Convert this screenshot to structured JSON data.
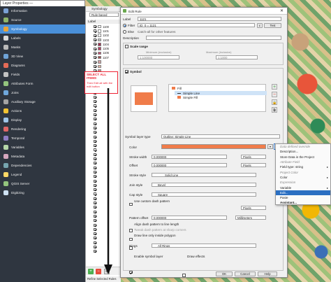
{
  "layer_dialog": {
    "title": "Layer Properties —",
    "sidebar": [
      {
        "label": "Information",
        "color": "#7aa0d4",
        "selected": false
      },
      {
        "label": "Source",
        "color": "#8fb56a",
        "selected": false
      },
      {
        "label": "Symbology",
        "color": "#e8a43a",
        "selected": true
      },
      {
        "label": "Labels",
        "color": "#d9d9d9",
        "selected": false
      },
      {
        "label": "Masks",
        "color": "#b9b9b9",
        "selected": false
      },
      {
        "label": "3D View",
        "color": "#6fa3d6",
        "selected": false
      },
      {
        "label": "Diagrams",
        "color": "#e46b57",
        "selected": false
      },
      {
        "label": "Fields",
        "color": "#c2c2c2",
        "selected": false
      },
      {
        "label": "Attributes Form",
        "color": "#93c47d",
        "selected": false
      },
      {
        "label": "Joins",
        "color": "#6fa8dc",
        "selected": false
      },
      {
        "label": "Auxiliary Storage",
        "color": "#a4a4a4",
        "selected": false
      },
      {
        "label": "Actions",
        "color": "#f1c232",
        "selected": false
      },
      {
        "label": "Display",
        "color": "#9fc5e8",
        "selected": false
      },
      {
        "label": "Rendering",
        "color": "#e06666",
        "selected": false
      },
      {
        "label": "Temporal",
        "color": "#8e7cc3",
        "selected": false
      },
      {
        "label": "Variables",
        "color": "#b6d7a8",
        "selected": false
      },
      {
        "label": "Metadata",
        "color": "#d5a6bd",
        "selected": false
      },
      {
        "label": "Dependencies",
        "color": "#76a5af",
        "selected": false
      },
      {
        "label": "Legend",
        "color": "#ffd966",
        "selected": false
      },
      {
        "label": "QGIS Server",
        "color": "#93c47d",
        "selected": false
      },
      {
        "label": "Digitizing",
        "color": "#cfe2f3",
        "selected": false
      }
    ]
  },
  "symbology": {
    "title": "Symbology",
    "renderer": "Rule-based",
    "column_label": "Label",
    "rows": [
      {
        "label": "1100",
        "color": "#ffffff"
      },
      {
        "label": "1101",
        "color": "#ffffff"
      },
      {
        "label": "1102",
        "color": "#ffffff"
      },
      {
        "label": "1103",
        "color": "#c0c0c0"
      },
      {
        "label": "1104",
        "color": "#a03050"
      },
      {
        "label": "1105",
        "color": "#b04060"
      },
      {
        "label": "1106",
        "color": "#c05070"
      },
      {
        "label": "1107",
        "color": "#a05050"
      },
      {
        "label": "",
        "color": "#d0a0a0"
      },
      {
        "label": "",
        "color": "#e0b0a0"
      },
      {
        "label": "",
        "color": "#d08080"
      },
      {
        "label": "",
        "color": "#c07070"
      },
      {
        "label": "",
        "color": "#f0a0a0"
      },
      {
        "label": "",
        "color": "#e09070"
      }
    ],
    "bottom_button": "Refine Selected Rules"
  },
  "annotation": {
    "heading": "SELECT ALL ITEMS",
    "text": "Then Edit all with the edit button"
  },
  "edit_rule": {
    "title": "Edit Rule",
    "label_caption": "Label",
    "label_value": "1121",
    "filter_caption": "Filter",
    "filter_value": "ID_0 = 1121",
    "filter_eps": "ε",
    "test_button": "Test",
    "else_caption": "Else",
    "else_text": "Catch-all for other features",
    "description_caption": "Description",
    "scale_range_caption": "Scale range",
    "minimum_caption": "Minimum (exclusive)",
    "maximum_caption": "Maximum (inclusive)",
    "minimum_value": "1:100000",
    "maximum_value": "1:1000",
    "symbol_caption": "Symbol",
    "tree": {
      "fill": "Fill",
      "line": "Simple Line",
      "simple_fill": "Simple Fill"
    },
    "fill_color": "#f07c4a",
    "symbol_layer_type_caption": "Symbol layer type",
    "symbol_layer_type_value": "Outline: Simple Line",
    "color_caption": "Color",
    "stroke_width_caption": "Stroke width",
    "stroke_width_value": "0.000000",
    "stroke_width_unit": "Pixels",
    "offset_caption": "Offset",
    "offset_value": "0.000000",
    "offset_unit": "Pixels",
    "stroke_style_caption": "Stroke style",
    "stroke_style_value": "Solid Line",
    "join_style_caption": "Join style",
    "join_style_value": "Bevel",
    "cap_style_caption": "Cap style",
    "cap_style_value": "Square",
    "custom_dash_caption": "Use custom dash pattern",
    "dash_unit": "Pixels",
    "pattern_offset_caption": "Pattern offset",
    "pattern_offset_value": "0.000000",
    "pattern_offset_unit": "Millimeters",
    "align_dash_caption": "Align dash pattern to line length",
    "tweak_dash_caption": "Tweak dash pattern at sharp corners",
    "draw_inside_caption": "Draw line only inside polygon",
    "rings_caption": "Rings",
    "rings_value": "All Rings",
    "enable_layer_caption": "Enable symbol layer",
    "draw_effects_caption": "Draw effects",
    "ok_button": "OK",
    "cancel_button": "Cancel",
    "help_button": "Help"
  },
  "context_menu": {
    "items": [
      {
        "label": "Data defined override",
        "type": "header"
      },
      {
        "label": "Description...",
        "type": "item"
      },
      {
        "label": "Store Data in the Project",
        "type": "item"
      },
      {
        "label": "Attribute Field",
        "type": "header"
      },
      {
        "label": "Field type: string",
        "type": "submenu"
      },
      {
        "label": "Project Color",
        "type": "header"
      },
      {
        "label": "Color",
        "type": "submenu"
      },
      {
        "label": "Expression",
        "type": "header"
      },
      {
        "label": "Variable",
        "type": "submenu"
      },
      {
        "label": "Edit...",
        "type": "highlight"
      },
      {
        "label": "Paste",
        "type": "item"
      },
      {
        "label": "Assistant...",
        "type": "bold"
      }
    ]
  }
}
